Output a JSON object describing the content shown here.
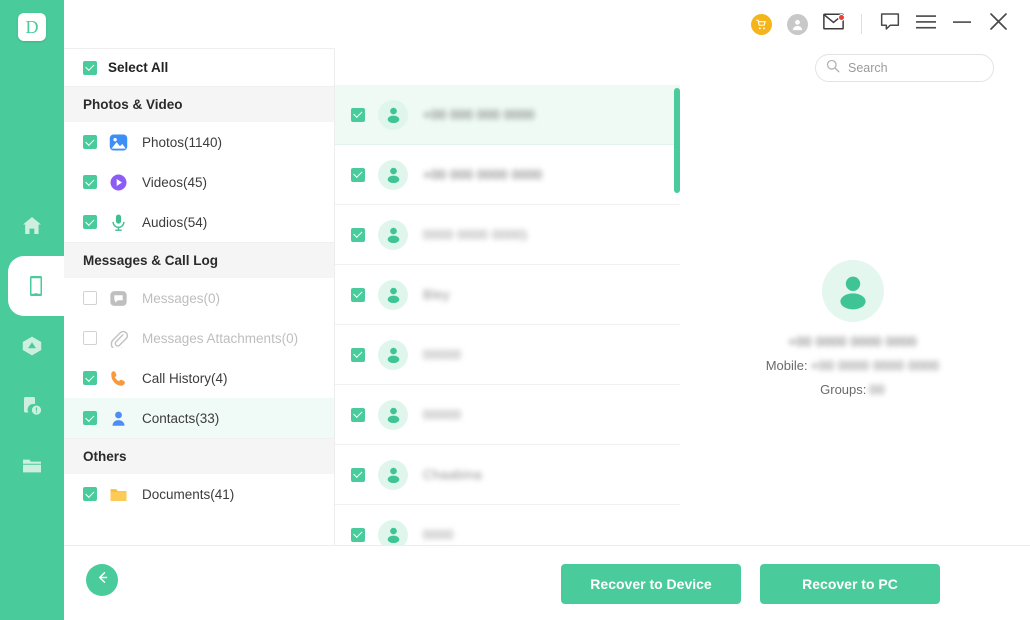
{
  "app": {
    "logo_letter": "D",
    "accent_color": "#4ACB9B",
    "header_bg": "#F5F5F5",
    "selected_row_color": "#F0FAF6",
    "cart_color": "#F5B41A",
    "badge_color": "#EA3E32"
  },
  "rail": {
    "items": [
      {
        "icon": "home-icon",
        "name": "home",
        "active": false
      },
      {
        "icon": "phone-device-icon",
        "name": "device",
        "active": true
      },
      {
        "icon": "cloud-icon",
        "name": "cloud",
        "active": false
      },
      {
        "icon": "device-repair-icon",
        "name": "repair",
        "active": false
      },
      {
        "icon": "folder-icon",
        "name": "toolbox",
        "active": false
      }
    ]
  },
  "titlebar": {
    "buttons": [
      {
        "icon": "cart-icon",
        "name": "store"
      },
      {
        "icon": "account-icon",
        "name": "account"
      },
      {
        "icon": "mail-icon",
        "name": "messages",
        "badge": true
      },
      {
        "icon": "feedback-icon",
        "name": "feedback"
      },
      {
        "icon": "menu-icon",
        "name": "menu"
      },
      {
        "icon": "minimize-icon",
        "name": "minimize"
      },
      {
        "icon": "close-icon",
        "name": "close"
      }
    ]
  },
  "search": {
    "placeholder": "Search",
    "value": "",
    "icon": "search-icon"
  },
  "categories": {
    "select_all_label": "Select All",
    "select_all_checked": true,
    "sections": [
      {
        "title": "Photos & Video",
        "items": [
          {
            "label": "Photos(1140)",
            "icon": "photos-icon",
            "checked": true,
            "disabled": false,
            "selected": false
          },
          {
            "label": "Videos(45)",
            "icon": "videos-icon",
            "checked": true,
            "disabled": false,
            "selected": false
          },
          {
            "label": "Audios(54)",
            "icon": "audios-icon",
            "checked": true,
            "disabled": false,
            "selected": false
          }
        ]
      },
      {
        "title": "Messages & Call Log",
        "items": [
          {
            "label": "Messages(0)",
            "icon": "messages-icon",
            "checked": false,
            "disabled": true,
            "selected": false
          },
          {
            "label": "Messages Attachments(0)",
            "icon": "attachment-icon",
            "checked": false,
            "disabled": true,
            "selected": false
          },
          {
            "label": "Call History(4)",
            "icon": "call-icon",
            "checked": true,
            "disabled": false,
            "selected": false
          },
          {
            "label": "Contacts(33)",
            "icon": "contacts-icon",
            "checked": true,
            "disabled": false,
            "selected": true
          }
        ]
      },
      {
        "title": "Others",
        "items": [
          {
            "label": "Documents(41)",
            "icon": "documents-icon",
            "checked": true,
            "disabled": false,
            "selected": false
          }
        ]
      }
    ]
  },
  "contact_list": {
    "rows": [
      {
        "name": "+00 000 000 0000",
        "checked": true,
        "selected": true,
        "width": 96,
        "dark": true
      },
      {
        "name": "+00 000 0000 0000",
        "checked": true,
        "selected": false,
        "width": 98,
        "dark": true
      },
      {
        "name": "0000 0000 0000)",
        "checked": true,
        "selected": false,
        "width": 84,
        "dark": false
      },
      {
        "name": "Bley",
        "checked": true,
        "selected": false,
        "width": 22,
        "dark": false
      },
      {
        "name": "00000",
        "checked": true,
        "selected": false,
        "width": 36,
        "dark": false
      },
      {
        "name": "00000",
        "checked": true,
        "selected": false,
        "width": 36,
        "dark": false
      },
      {
        "name": "Chaabina",
        "checked": true,
        "selected": false,
        "width": 52,
        "dark": false
      },
      {
        "name": "0000",
        "checked": true,
        "selected": false,
        "width": 28,
        "dark": false
      }
    ]
  },
  "detail": {
    "avatar_icon": "contact-avatar-icon",
    "name": "+00 0000 0000 0000",
    "mobile_label": "Mobile:",
    "mobile_value": "+00 0000 0000 0000",
    "groups_label": "Groups:",
    "groups_value": "00"
  },
  "footer": {
    "back_icon": "arrow-left-icon",
    "recover_device_label": "Recover to Device",
    "recover_pc_label": "Recover to PC"
  }
}
